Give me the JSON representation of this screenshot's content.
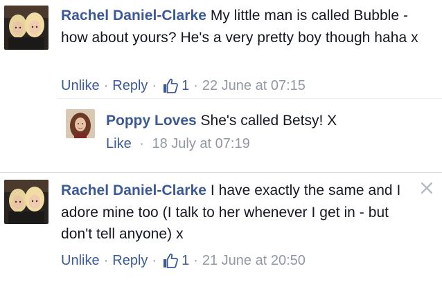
{
  "comments": [
    {
      "author": "Rachel Daniel-Clarke",
      "text": "My little man is called Bubble - how about yours? He's a very pretty boy though haha x",
      "actions": {
        "unlike_label": "Unlike",
        "reply_label": "Reply",
        "like_count": "1",
        "timestamp": "22 June at 07:15",
        "separator": "·"
      },
      "replies": [
        {
          "author": "Poppy Loves",
          "text": "She's called Betsy! X",
          "actions": {
            "like_label": "Like",
            "timestamp": "18 July at 07:19",
            "separator": "·"
          }
        }
      ]
    },
    {
      "author": "Rachel Daniel-Clarke",
      "text": "I have exactly the same and I adore mine too (I talk to her whenever I get in - but don't tell anyone) x",
      "actions": {
        "unlike_label": "Unlike",
        "reply_label": "Reply",
        "like_count": "1",
        "timestamp": "21 June at 20:50",
        "separator": "·"
      }
    }
  ],
  "icons": {
    "thumb": "thumbs-up-icon",
    "close": "close-icon"
  },
  "colors": {
    "link": "#3b5998",
    "meta": "#9197a3",
    "text": "#141823",
    "divider": "#dcdee3"
  }
}
